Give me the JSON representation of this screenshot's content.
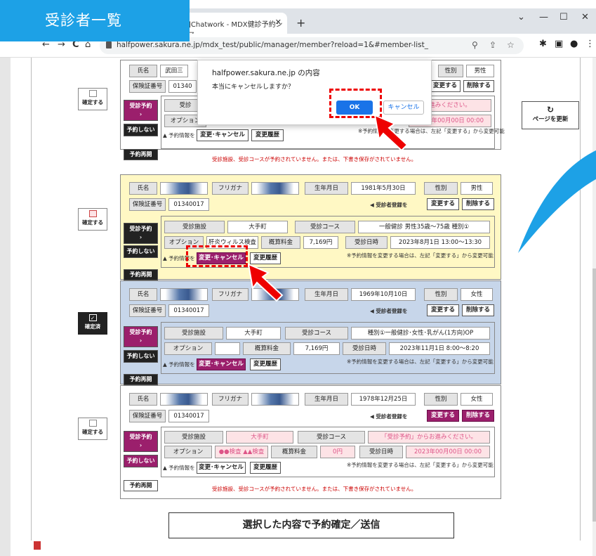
{
  "overlay_title": "受診者一覧",
  "browser": {
    "tab_title": "]Chatwork - MDX健診予約シス",
    "tab_close": "✕",
    "new_tab": "+",
    "url": "halfpower.sakura.ne.jp/mdx_test/public/manager/member?reload=1&#member-list_",
    "window_controls": [
      "⌄",
      "—",
      "☐",
      "✕"
    ],
    "nav": [
      "←",
      "→",
      "C",
      "⌂"
    ]
  },
  "dialog": {
    "title": "halfpower.sakura.ne.jp の内容",
    "message": "本当にキャンセルしますか？",
    "ok": "OK",
    "cancel": "キャンセル"
  },
  "refresh_button": {
    "icon": "↻",
    "label": "ページを更新"
  },
  "submit_button": "選択した内容で予約確定／送信",
  "labels": {
    "name": "氏名",
    "furigana": "フリガナ",
    "birthdate": "生年月日",
    "gender": "性別",
    "insurance": "保険証番号",
    "register_hint": "◀ 受診者登録を",
    "edit": "変更する",
    "delete": "削除する",
    "reserve": "受診予約",
    "reserve_arrow": "›",
    "no_reserve": "予約しない",
    "resume": "予約再開",
    "facility": "受診施設",
    "course": "受診コース",
    "option": "オプション",
    "estimate": "概算料金",
    "datetime": "受診日時",
    "reserve_info": "▲ 予約情報を",
    "change_cancel": "変更･キャンセル",
    "history": "変更履歴",
    "change_note": "※予約情報を変更する場合は、左記「変更する」から変更可能",
    "warning": "受診施設、受診コースが予約されていません。または、下書き保存がされていません。",
    "confirm": "確定する",
    "confirmed": "確定済"
  },
  "members": [
    {
      "name": "武田三",
      "insurance": "01340",
      "gender": "男性",
      "facility": "受診",
      "datetime": "2023年00月00日 00:00",
      "prompt": "進みください。"
    },
    {
      "birthdate": "1981年5月30日",
      "gender": "男性",
      "insurance": "01340017",
      "facility": "大手町",
      "course": "一般健診 男性35歳〜75歳 種別①",
      "option": "肝炎ウィルス検査",
      "estimate": "7,169円",
      "datetime": "2023年8月1日 13:00〜13:30"
    },
    {
      "birthdate": "1969年10月10日",
      "gender": "女性",
      "insurance": "01340017",
      "facility": "大手町",
      "course": "種別①一般健診･女性･乳がん(1方向)OP",
      "option": "",
      "estimate": "7,169円",
      "datetime": "2023年11月1日 8:00〜8:20"
    },
    {
      "birthdate": "1978年12月25日",
      "gender": "女性",
      "insurance": "01340017",
      "facility": "大手町",
      "course": "「受診予約」からお進みください。",
      "option": "●●検査 ▲▲検査",
      "estimate": "0円",
      "datetime": "2023年00月00日 00:00"
    }
  ],
  "colors": {
    "accent": "#1da1e6",
    "magenta": "#9b1f6c",
    "highlight": "#e00000",
    "ok_blue": "#1a73e8"
  }
}
